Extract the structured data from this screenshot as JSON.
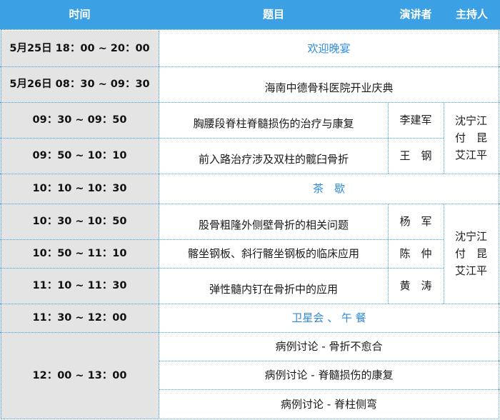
{
  "header": {
    "time": "时间",
    "topic": "题目",
    "speaker": "演讲者",
    "host": "主持人"
  },
  "rows": {
    "r1": {
      "time": "5月25日  18：00 ~ 20：00",
      "topic": "欢迎晚宴"
    },
    "r2": {
      "time": "5月26日  08：30 ~ 09：30",
      "topic": "海南中德骨科医院开业庆典"
    },
    "r3": {
      "time": "09：30 ~ 09：50",
      "topic": "胸腰段脊柱脊髓损伤的治疗与康复",
      "speaker": "李建军"
    },
    "r4": {
      "time": "09：50 ~ 10：10",
      "topic": "前入路治疗涉及双柱的髋臼骨折",
      "speaker": "王　钢"
    },
    "r5": {
      "time": "10：10 ~ 10：30",
      "topic": "茶　歇"
    },
    "r6": {
      "time": "10：30 ~ 10：50",
      "topic": "股骨粗隆外侧壁骨折的相关问题",
      "speaker": "杨　军"
    },
    "r7": {
      "time": "10：50 ~ 11：10",
      "topic": "髂坐钢板、斜行髂坐钢板的临床应用",
      "speaker": "陈　仲"
    },
    "r8": {
      "time": "11：10 ~ 11：30",
      "topic": "弹性髓内钉在骨折中的应用",
      "speaker": "黄　涛"
    },
    "r9": {
      "time": "11：30 ~ 12：00",
      "topic": "卫星会 、 午 餐"
    },
    "r10": {
      "time": "12：00 ~ 13：00",
      "topics": [
        "病例讨论 - 骨折不愈合",
        "病例讨论 - 脊髓损伤的康复",
        "病例讨论 - 脊柱侧弯"
      ]
    }
  },
  "hosts": {
    "g1": [
      "沈宁江",
      "付　昆",
      "艾江平"
    ],
    "g2": [
      "沈宁江",
      "付　昆",
      "艾江平"
    ]
  },
  "colors": {
    "header_bg": "#3ba0e4",
    "time_bg": "#e4e4e4",
    "accent_text": "#2f8ad6",
    "border": "#3ba0e4"
  }
}
